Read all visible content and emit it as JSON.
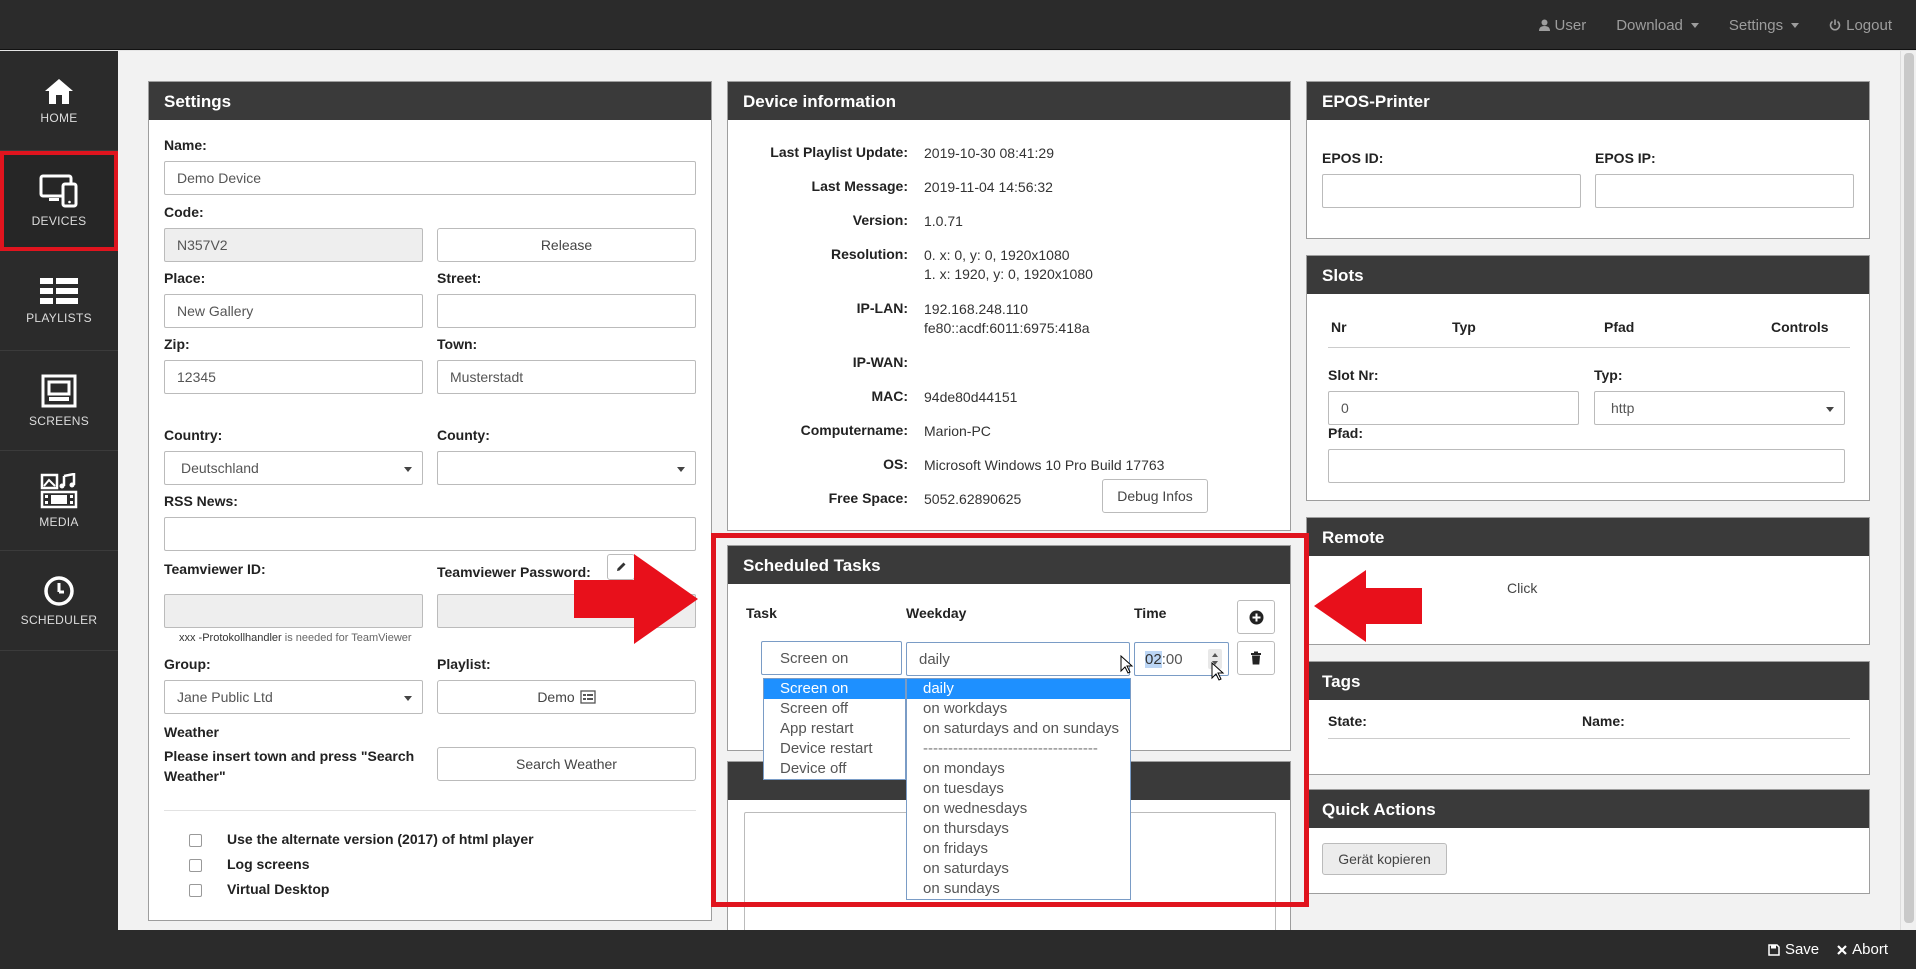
{
  "topnav": {
    "user": "User",
    "download": "Download",
    "settings": "Settings",
    "logout": "Logout"
  },
  "sidebar": {
    "items": [
      {
        "label": "HOME",
        "icon": "home-icon"
      },
      {
        "label": "DEVICES",
        "icon": "devices-icon",
        "active": true
      },
      {
        "label": "PLAYLISTS",
        "icon": "playlists-icon"
      },
      {
        "label": "SCREENS",
        "icon": "screens-icon"
      },
      {
        "label": "MEDIA",
        "icon": "media-icon"
      },
      {
        "label": "SCHEDULER",
        "icon": "scheduler-icon"
      }
    ]
  },
  "settings": {
    "title": "Settings",
    "name_label": "Name:",
    "name_value": "Demo Device",
    "code_label": "Code:",
    "code_value": "N357V2",
    "release_label": "Release",
    "place_label": "Place:",
    "place_value": "New Gallery",
    "street_label": "Street:",
    "street_value": "",
    "zip_label": "Zip:",
    "zip_value": "12345",
    "town_label": "Town:",
    "town_value": "Musterstadt",
    "country_label": "Country:",
    "country_value": "Deutschland",
    "county_label": "County:",
    "county_value": "",
    "rss_label": "RSS News:",
    "rss_value": "",
    "tv_id_label": "Teamviewer ID:",
    "tv_pw_label": "Teamviewer Password:",
    "tv_note_prefix": "xxx -Protokollhandler",
    "tv_note_suffix": " is needed for TeamViewer",
    "group_label": "Group:",
    "group_value": "Jane Public Ltd",
    "playlist_label": "Playlist:",
    "playlist_value": "Demo",
    "weather_label": "Weather",
    "weather_hint": "Please insert town and press \"Search Weather\"",
    "search_weather_label": "Search Weather",
    "checkbox_alt": "Use the alternate version (2017) of html player",
    "checkbox_log": "Log screens",
    "checkbox_virtual": "Virtual Desktop"
  },
  "device_info": {
    "title": "Device information",
    "rows": [
      {
        "key": "Last Playlist Update:",
        "value": "2019-10-30 08:41:29"
      },
      {
        "key": "Last Message:",
        "value": "2019-11-04 14:56:32"
      },
      {
        "key": "Version:",
        "value": "1.0.71"
      },
      {
        "key": "Resolution:",
        "value": "0. x: 0, y: 0, 1920x1080",
        "value2": "1. x: 1920, y: 0, 1920x1080"
      },
      {
        "key": "IP-LAN:",
        "value": "192.168.248.110",
        "value2": "fe80::acdf:6011:6975:418a"
      },
      {
        "key": "IP-WAN:",
        "value": ""
      },
      {
        "key": "MAC:",
        "value": "94de80d44151"
      },
      {
        "key": "Computername:",
        "value": "Marion-PC"
      },
      {
        "key": "OS:",
        "value": "Microsoft Windows 10 Pro Build 17763"
      },
      {
        "key": "Free Space:",
        "value": "5052.62890625"
      }
    ],
    "debug_label": "Debug Infos"
  },
  "scheduled": {
    "title": "Scheduled Tasks",
    "task_header": "Task",
    "weekday_header": "Weekday",
    "time_header": "Time",
    "task_value": "Screen on",
    "weekday_value": "daily",
    "time_hours": "02",
    "time_sep": ":",
    "time_minutes": "00",
    "task_options": [
      "Screen on",
      "Screen off",
      "App restart",
      "Device restart",
      "Device off"
    ],
    "weekday_options": [
      "daily",
      "on workdays",
      "on saturdays and on sundays",
      "-----------------------------------",
      "on mondays",
      "on tuesdays",
      "on wednesdays",
      "on thursdays",
      "on fridays",
      "on saturdays",
      "on sundays"
    ]
  },
  "epos": {
    "title": "EPOS-Printer",
    "id_label": "EPOS ID:",
    "ip_label": "EPOS IP:"
  },
  "slots": {
    "title": "Slots",
    "columns": [
      "Nr",
      "Typ",
      "Pfad",
      "Controls"
    ],
    "slot_nr_label": "Slot Nr:",
    "slot_nr_value": "0",
    "typ_label": "Typ:",
    "typ_value": "http",
    "pfad_label": "Pfad:"
  },
  "remote": {
    "title": "Remote",
    "click_label": "Click"
  },
  "tags": {
    "title": "Tags",
    "state_label": "State:",
    "name_label": "Name:"
  },
  "quick_actions": {
    "title": "Quick Actions",
    "copy_label": "Gerät kopieren"
  },
  "footer": {
    "save": "Save",
    "abort": "Abort"
  }
}
